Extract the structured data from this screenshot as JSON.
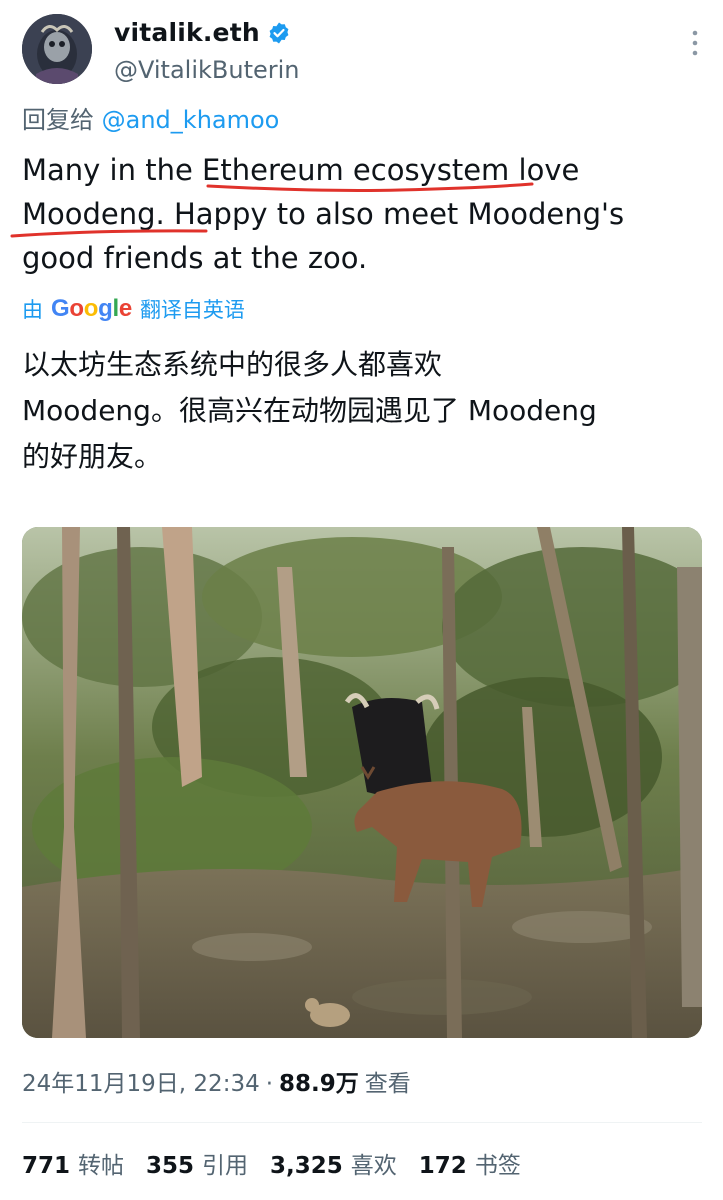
{
  "author": {
    "display_name": "vitalik.eth",
    "handle": "@VitalikButerin",
    "verified_icon": "verified-badge-icon",
    "verified_color": "#1d9bf0"
  },
  "reply": {
    "prefix": "回复给",
    "mention": "@and_khamoo"
  },
  "tweet": {
    "line1_a": "Many in the ",
    "line1_b": "Ethereum ecosystem",
    "line1_c": " love",
    "line2_a": "Moodeng.",
    "line2_b": " Happy to also meet Moodeng's",
    "line3": "good friends at the zoo.",
    "underline_color": "#e0322b"
  },
  "translation": {
    "prefix": "由",
    "google": "Google",
    "suffix": "翻译自英语",
    "line1": "以太坊生态系统中的很多人都喜欢",
    "line2": "Moodeng。很高兴在动物园遇见了 Moodeng",
    "line3": "的好朋友。"
  },
  "media": {
    "kind": "photo",
    "subject": "gaur and banteng in zoo forest"
  },
  "meta": {
    "timestamp": "24年11月19日, 22:34",
    "separator": "·",
    "views": "88.9万",
    "views_label": "查看"
  },
  "stats": [
    {
      "count": "771",
      "label": "转帖"
    },
    {
      "count": "355",
      "label": "引用"
    },
    {
      "count": "3,325",
      "label": "喜欢"
    },
    {
      "count": "172",
      "label": "书签"
    }
  ],
  "colors": {
    "text": "#0f1419",
    "secondary": "#536471",
    "link": "#1d9bf0"
  }
}
